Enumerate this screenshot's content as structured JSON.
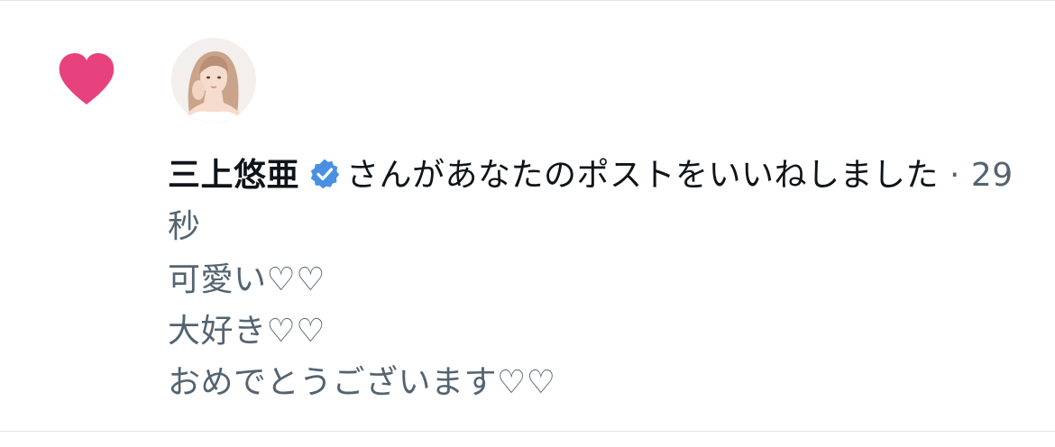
{
  "notification": {
    "icon": "heart-icon",
    "icon_color": "#e8427e",
    "user_name": "三上悠亜",
    "verified_icon": "verified-badge-icon",
    "verified_color": "#4a90e2",
    "action_text": "さんがあなたのポストをいいねしました",
    "separator": " · ",
    "time_ago": "29 秒",
    "post_text": [
      "可愛い♡♡",
      "大好き♡♡",
      "おめでとうございます♡♡"
    ]
  },
  "colors": {
    "primary_text": "#0f1419",
    "secondary_text": "#536471",
    "divider": "#e3e6e9"
  }
}
